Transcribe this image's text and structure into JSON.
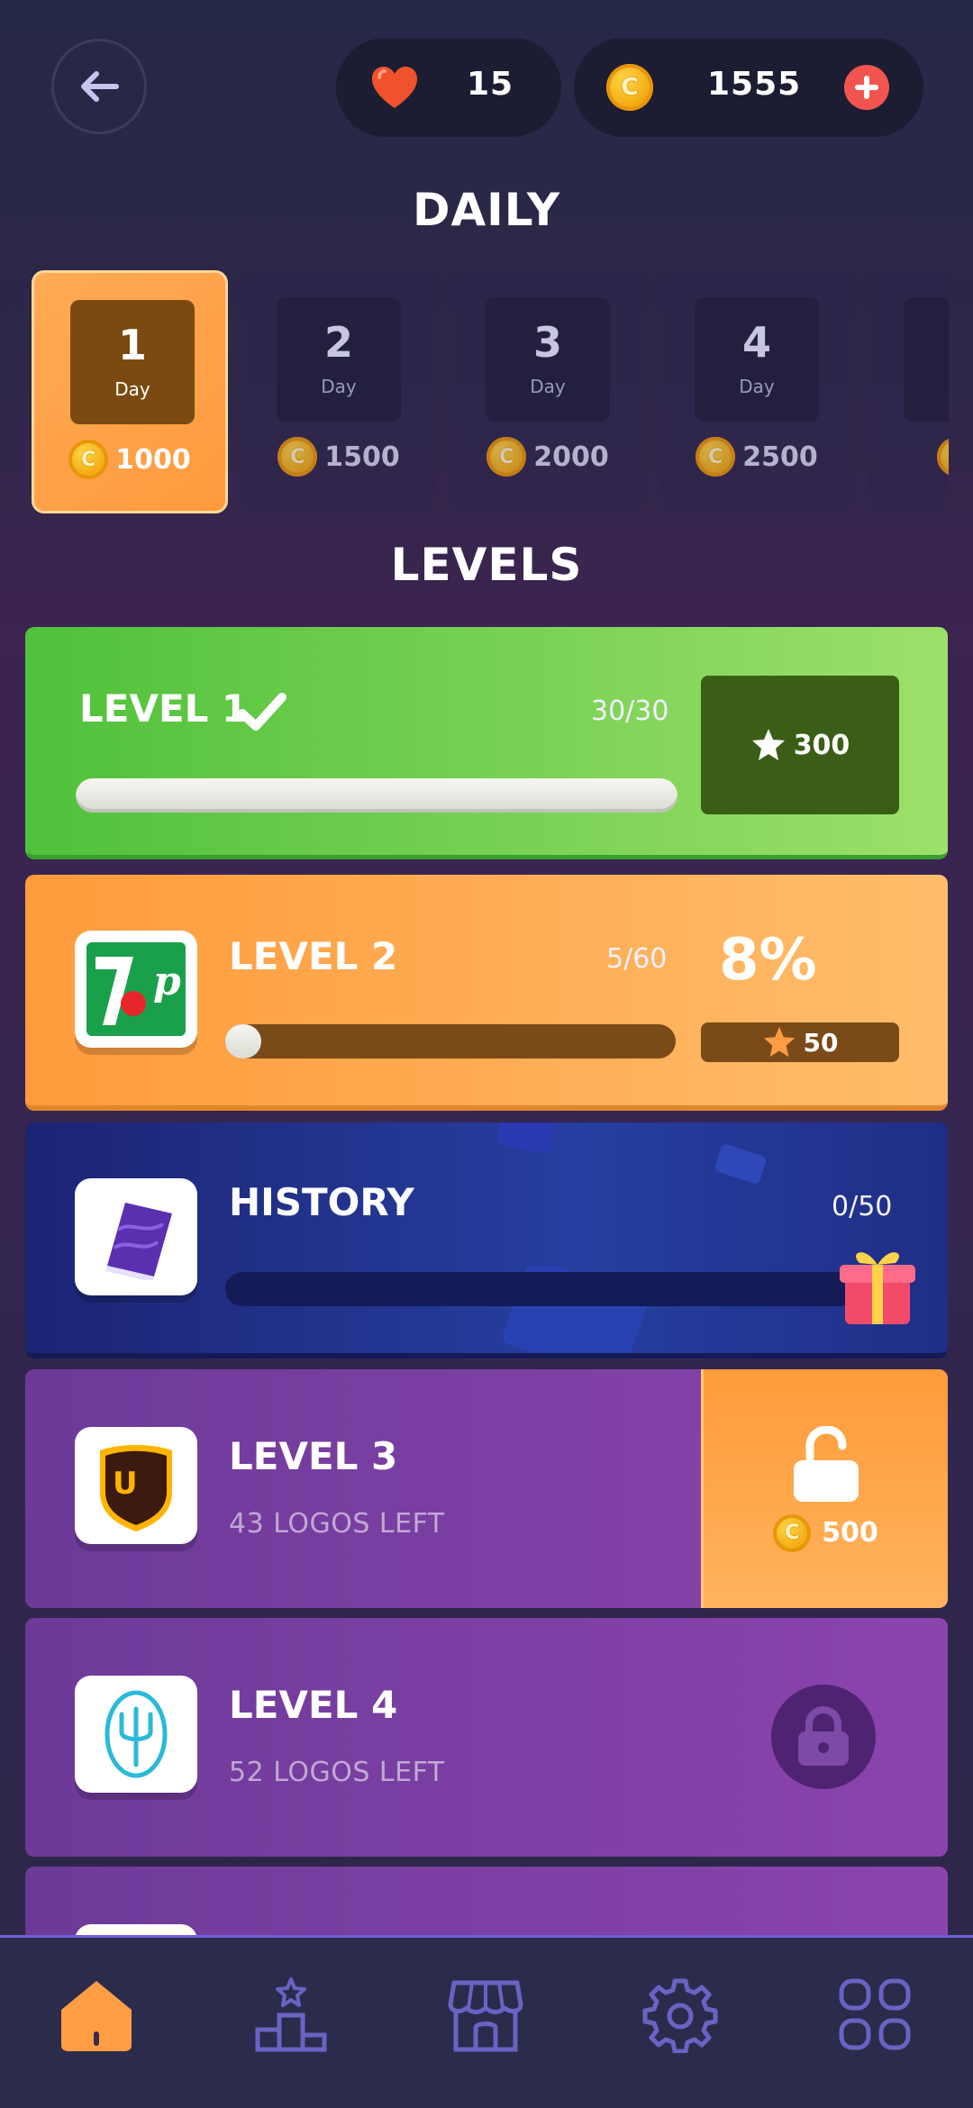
{
  "header": {
    "hearts": "15",
    "coins": "1555"
  },
  "daily": {
    "title": "DAILY",
    "days": [
      {
        "number": "1",
        "label": "Day",
        "reward": "1000",
        "active": true
      },
      {
        "number": "2",
        "label": "Day",
        "reward": "1500",
        "active": false
      },
      {
        "number": "3",
        "label": "Day",
        "reward": "2000",
        "active": false
      },
      {
        "number": "4",
        "label": "Day",
        "reward": "2500",
        "active": false
      }
    ]
  },
  "levels": {
    "title": "LEVELS",
    "items": [
      {
        "title": "LEVEL 1",
        "progress": "30/30",
        "progress_fraction": 1.0,
        "stars": "300",
        "completed": true
      },
      {
        "title": "LEVEL 2",
        "progress": "5/60",
        "progress_fraction": 0.08,
        "percent": "8%",
        "stars": "50"
      },
      {
        "title": "HISTORY",
        "progress": "0/50",
        "progress_fraction": 0.0
      },
      {
        "title": "LEVEL 3",
        "subtitle": "43 LOGOS LEFT",
        "unlock_cost": "500",
        "locked": true
      },
      {
        "title": "LEVEL 4",
        "subtitle": "52 LOGOS LEFT",
        "locked": true
      }
    ]
  },
  "nav": {
    "items": [
      "home-icon",
      "leaderboard-icon",
      "shop-icon",
      "settings-icon",
      "more-apps-icon"
    ],
    "active": "home-icon"
  },
  "colors": {
    "accent": "#ff9d45",
    "green": "#6cd04a",
    "purple": "#7b3ca6",
    "navy": "#1e2f8c"
  }
}
